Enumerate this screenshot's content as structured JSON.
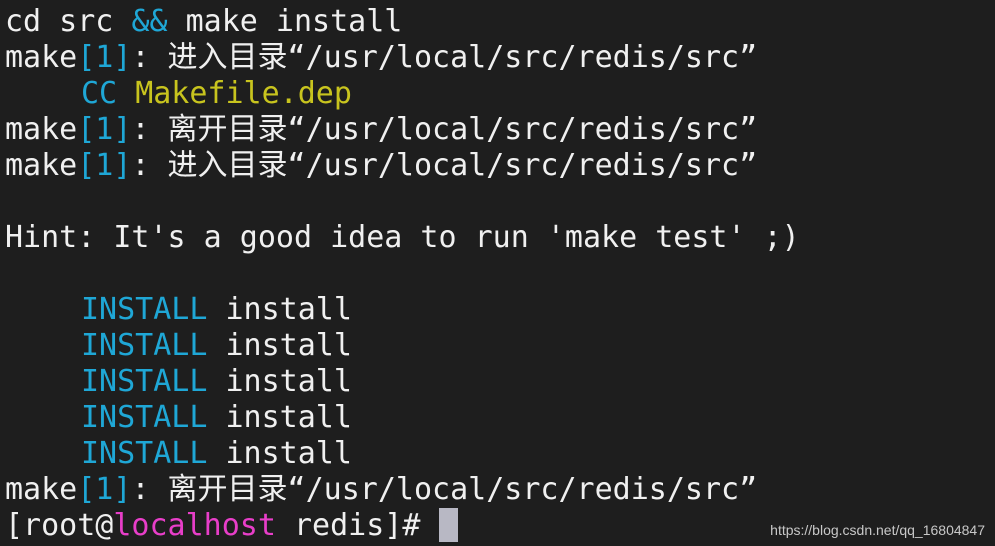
{
  "lines": {
    "l1": {
      "a": "cd src ",
      "op": "&&",
      "b": " make install"
    },
    "l2": {
      "make": "make",
      "level": "[1]",
      "msg": ": 进入目录“/usr/local/src/redis/src”"
    },
    "l3": {
      "tag": "CC",
      "file": "Makefile.dep"
    },
    "l4": {
      "make": "make",
      "level": "[1]",
      "msg": ": 离开目录“/usr/local/src/redis/src”"
    },
    "l5": {
      "make": "make",
      "level": "[1]",
      "msg": ": 进入目录“/usr/local/src/redis/src”"
    },
    "hint": "Hint: It's a good idea to run 'make test' ;)",
    "installs": [
      {
        "tag": "INSTALL",
        "target": " install"
      },
      {
        "tag": "INSTALL",
        "target": " install"
      },
      {
        "tag": "INSTALL",
        "target": " install"
      },
      {
        "tag": "INSTALL",
        "target": " install"
      },
      {
        "tag": "INSTALL",
        "target": " install"
      }
    ],
    "l_last": {
      "make": "make",
      "level": "[1]",
      "msg": ": 离开目录“/usr/local/src/redis/src”"
    }
  },
  "prompt": {
    "open": "[root@",
    "host": "localhost",
    "rest": " redis]# "
  },
  "watermark": "https://blog.csdn.net/qq_16804847",
  "colors": {
    "background": "#1e1e1e",
    "text": "#f0f0f0",
    "cyan": "#1fa7d6",
    "yellow": "#c8c41e",
    "magenta": "#e83ec9",
    "cursor": "#b8b8c4"
  }
}
